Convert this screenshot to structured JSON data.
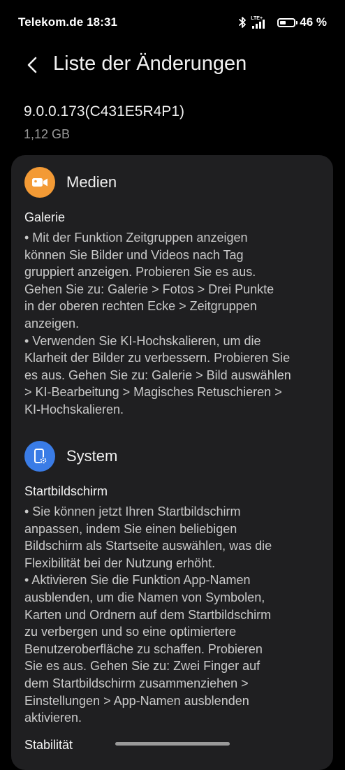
{
  "status_bar": {
    "carrier_time": "Telekom.de 18:31",
    "network_tag": "LTE+",
    "battery": "46 %",
    "battery_level": 0.46
  },
  "header": {
    "title": "Liste der Änderungen"
  },
  "update": {
    "version": "9.0.0.173(C431E5R4P1)",
    "size": "1,12 GB"
  },
  "colors": {
    "media_icon_bg": "#f39a35",
    "system_icon_bg": "#3a7ce6",
    "card_bg": "#1f1f21"
  },
  "sections": [
    {
      "icon": "video-camera-icon",
      "label": "Medien",
      "subtitle": "Galerie",
      "lines": [
        "• Mit der Funktion Zeitgruppen anzeigen",
        "können Sie Bilder und Videos nach Tag",
        "gruppiert anzeigen. Probieren Sie es aus.",
        "Gehen Sie zu: Galerie > Fotos > Drei Punkte",
        "in der oberen rechten Ecke > Zeitgruppen",
        "anzeigen.",
        "• Verwenden Sie KI-Hochskalieren, um die",
        "Klarheit der Bilder zu verbessern. Probieren Sie",
        "es aus. Gehen Sie zu: Galerie > Bild auswählen",
        "> KI-Bearbeitung > Magisches Retuschieren >",
        "KI-Hochskalieren."
      ]
    },
    {
      "icon": "phone-settings-icon",
      "label": "System",
      "subtitle": "Startbildschirm",
      "lines": [
        "• Sie können jetzt Ihren Startbildschirm",
        "anpassen, indem Sie einen beliebigen",
        "Bildschirm als Startseite auswählen, was die",
        "Flexibilität bei der Nutzung erhöht.",
        "• Aktivieren Sie die Funktion App-Namen",
        "ausblenden, um die Namen von Symbolen,",
        "Karten und Ordnern auf dem Startbildschirm",
        "zu verbergen und so eine optimiertere",
        "Benutzeroberfläche zu schaffen. Probieren",
        "Sie es aus. Gehen Sie zu: Zwei Finger auf",
        "dem Startbildschirm zusammenziehen >",
        "Einstellungen > App-Namen ausblenden",
        "aktivieren."
      ],
      "next_subtitle": "Stabilität"
    }
  ]
}
